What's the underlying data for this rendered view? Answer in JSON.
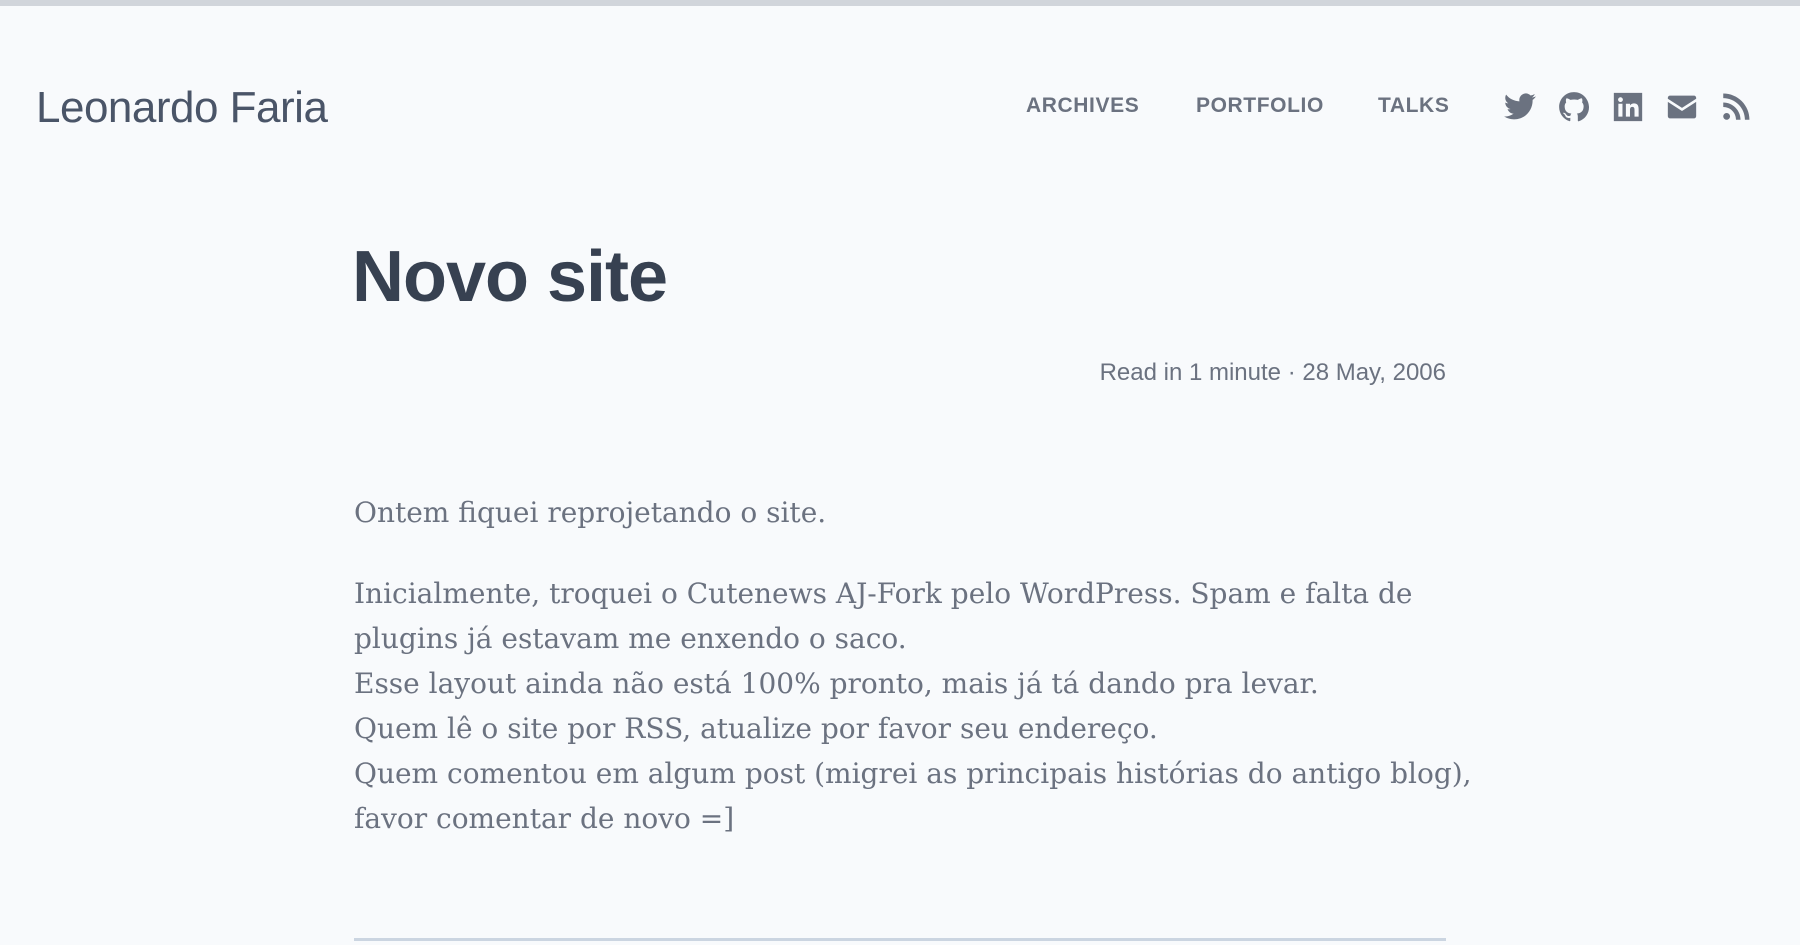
{
  "site": {
    "title": "Leonardo Faria"
  },
  "nav": {
    "items": [
      "ARCHIVES",
      "PORTFOLIO",
      "TALKS"
    ]
  },
  "social": {
    "icons": [
      "twitter-icon",
      "github-icon",
      "linkedin-icon",
      "mail-icon",
      "rss-icon"
    ]
  },
  "post": {
    "title": "Novo site",
    "meta": "Read in 1 minute · 28 May, 2006",
    "paragraphs": [
      [
        "Ontem fiquei reprojetando o site."
      ],
      [
        "Inicialmente, troquei o Cutenews AJ-Fork pelo WordPress. Spam e falta de",
        "plugins já estavam me enxendo o saco.",
        "Esse layout ainda não está 100% pronto, mais já tá dando pra levar.",
        "Quem lê o site por RSS, atualize por favor seu endereço.",
        "Quem comentou em algum post (migrei as principais histórias do antigo blog),",
        "favor comentar de novo =]"
      ]
    ]
  },
  "colors": {
    "background": "#f8fafc",
    "text": "#374151",
    "muted": "#6b7280",
    "divider": "#cbd5e1"
  }
}
